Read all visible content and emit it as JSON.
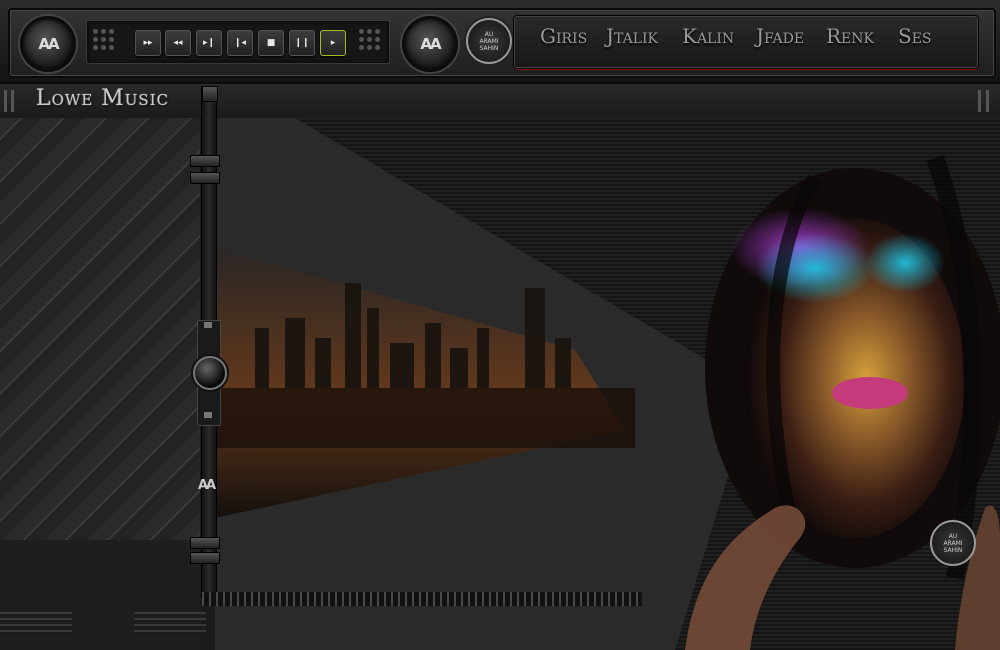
{
  "logo": {
    "text": "AA"
  },
  "transport": {
    "buttons": [
      {
        "name": "fast-forward",
        "glyph": "▸▸"
      },
      {
        "name": "rewind",
        "glyph": "◂◂"
      },
      {
        "name": "next",
        "glyph": "▸❙"
      },
      {
        "name": "previous",
        "glyph": "❙◂"
      },
      {
        "name": "stop",
        "glyph": "■"
      },
      {
        "name": "pause",
        "glyph": "❙❙"
      },
      {
        "name": "play",
        "glyph": "▸"
      }
    ]
  },
  "badge": {
    "line1": "AU",
    "line2": "ARAMI",
    "line3": "SAHIN"
  },
  "nav": {
    "items": [
      "Giris",
      "Jtalik",
      "Kalin",
      "Jfade",
      "Renk",
      "Ses"
    ]
  },
  "site": {
    "title": "Lowe Music"
  },
  "slider": {
    "logo": "AA",
    "value": 0.55
  },
  "colors": {
    "accent": "#a0c020",
    "nav_underline": "#7a1010"
  }
}
